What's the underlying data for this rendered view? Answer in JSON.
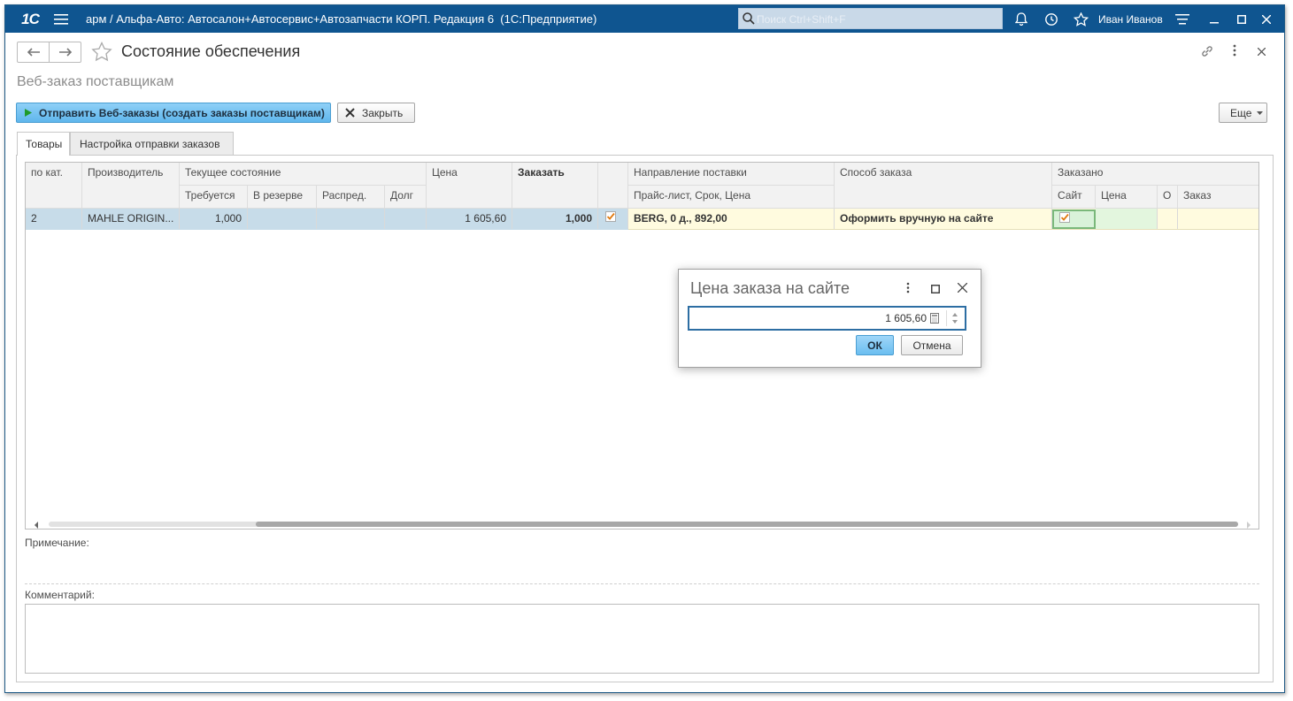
{
  "app": {
    "logo": "1С",
    "title": "арм / Альфа-Авто: Автосалон+Автосервис+Автозапчасти КОРП. Редакция 6  (1С:Предприятие)",
    "search_placeholder": "Поиск Ctrl+Shift+F",
    "user": "Иван Иванов"
  },
  "page": {
    "title": "Состояние обеспечения",
    "subtitle": "Веб-заказ поставщикам"
  },
  "toolbar": {
    "send_label": "Отправить Веб-заказы (создать заказы поставщикам)",
    "close_label": "Закрыть",
    "more_label": "Еще"
  },
  "tabs": [
    {
      "label": "Товары",
      "active": true
    },
    {
      "label": "Настройка отправки заказов",
      "active": false
    }
  ],
  "grid": {
    "headers": {
      "cat_no": "по кат.",
      "manufacturer": "Производитель",
      "current_state": "Текущее состояние",
      "required": "Требуется",
      "reserved": "В резерве",
      "distributed": "Распред.",
      "debt": "Долг",
      "price": "Цена",
      "order": "Заказать",
      "direction": "Направление поставки",
      "price_list": "Прайс-лист, Срок, Цена",
      "order_method": "Способ заказа",
      "ordered": "Заказано",
      "site": "Сайт",
      "ordered_price": "Цена",
      "o": "О",
      "ordered_order": "Заказ"
    },
    "rows": [
      {
        "cat_no": "2",
        "manufacturer": "MAHLE ORIGIN...",
        "required": "1,000",
        "reserved": "",
        "distributed": "",
        "debt": "",
        "price": "1 605,60",
        "order": "1,000",
        "order_checked": true,
        "price_list": "BERG, 0 д., 892,00",
        "order_method": "Оформить вручную на сайте",
        "site_checked": true,
        "ordered_price": "",
        "o": "",
        "ordered_order": ""
      }
    ]
  },
  "note": {
    "label": "Примечание:"
  },
  "comment": {
    "label": "Комментарий:",
    "value": ""
  },
  "dialog": {
    "title": "Цена заказа на сайте",
    "value": "1 605,60",
    "ok_label": "ОК",
    "cancel_label": "Отмена"
  },
  "colors": {
    "titlebar": "#0f5590",
    "primary_button": "#6bbef0",
    "selected_row": "#c7dce9",
    "highlight_row": "#fffbdf",
    "dialog_border": "#2d6ea3"
  }
}
